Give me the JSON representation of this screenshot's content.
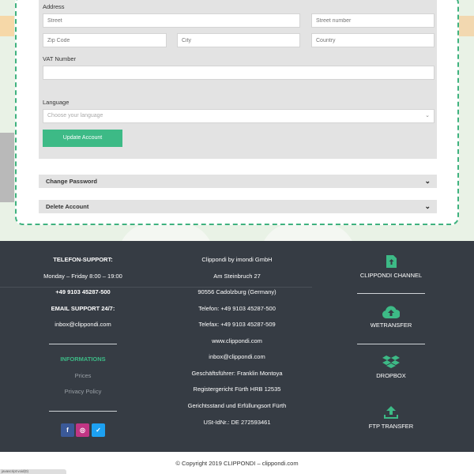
{
  "form": {
    "address_label": "Address",
    "street_placeholder": "Street",
    "street_number_placeholder": "Street number",
    "zip_placeholder": "Zip Code",
    "city_placeholder": "City",
    "country_placeholder": "Country",
    "vat_label": "VAT Number",
    "vat_value": "",
    "language_label": "Language",
    "language_placeholder": "Choose your language",
    "save_button": "Update Account"
  },
  "accordion": {
    "change_password": "Change Password",
    "delete_account": "Delete Account"
  },
  "footer": {
    "support_title": "TELEFON-SUPPORT:",
    "support_hours": "Monday – Friday 8:00 – 19:00",
    "support_phone": "+49 9103 45287-500",
    "email_title": "EMAIL SUPPORT 24/7:",
    "email": "inbox@clippondi.com",
    "info_title": "INFORMATIONS",
    "info_links": [
      "Prices",
      "Privacy Policy"
    ],
    "company_lines": [
      "Clippondi by imondi GmbH",
      "Am Steinbruch 27",
      "90556 Cadolzburg (Germany)",
      "Telefon: +49 9103 45287-500",
      "Telefax: +49 9103 45287-509",
      "www.clippondi.com",
      "inbox@clippondi.com",
      "Geschäftsführer: Franklin Montoya",
      "Registergericht Fürth HRB 12535",
      "Gerichtsstand und Erfüllungsort Fürth",
      "USt-IdNr.: DE 272593461"
    ],
    "services": [
      "CLIPPONDI CHANNEL",
      "WETRANSFER",
      "DROPBOX",
      "FTP TRANSFER"
    ],
    "social": [
      {
        "icon": "facebook-icon",
        "glyph": "f",
        "color": "#3b5998"
      },
      {
        "icon": "instagram-icon",
        "glyph": "◎",
        "color": "#c13584"
      },
      {
        "icon": "twitter-icon",
        "glyph": "✓",
        "color": "#1da1f2"
      }
    ]
  },
  "copyright": "© Copyright 2019 CLIPPONDI – clippondi.com",
  "status_tooltip": "javascript:void(0)"
}
